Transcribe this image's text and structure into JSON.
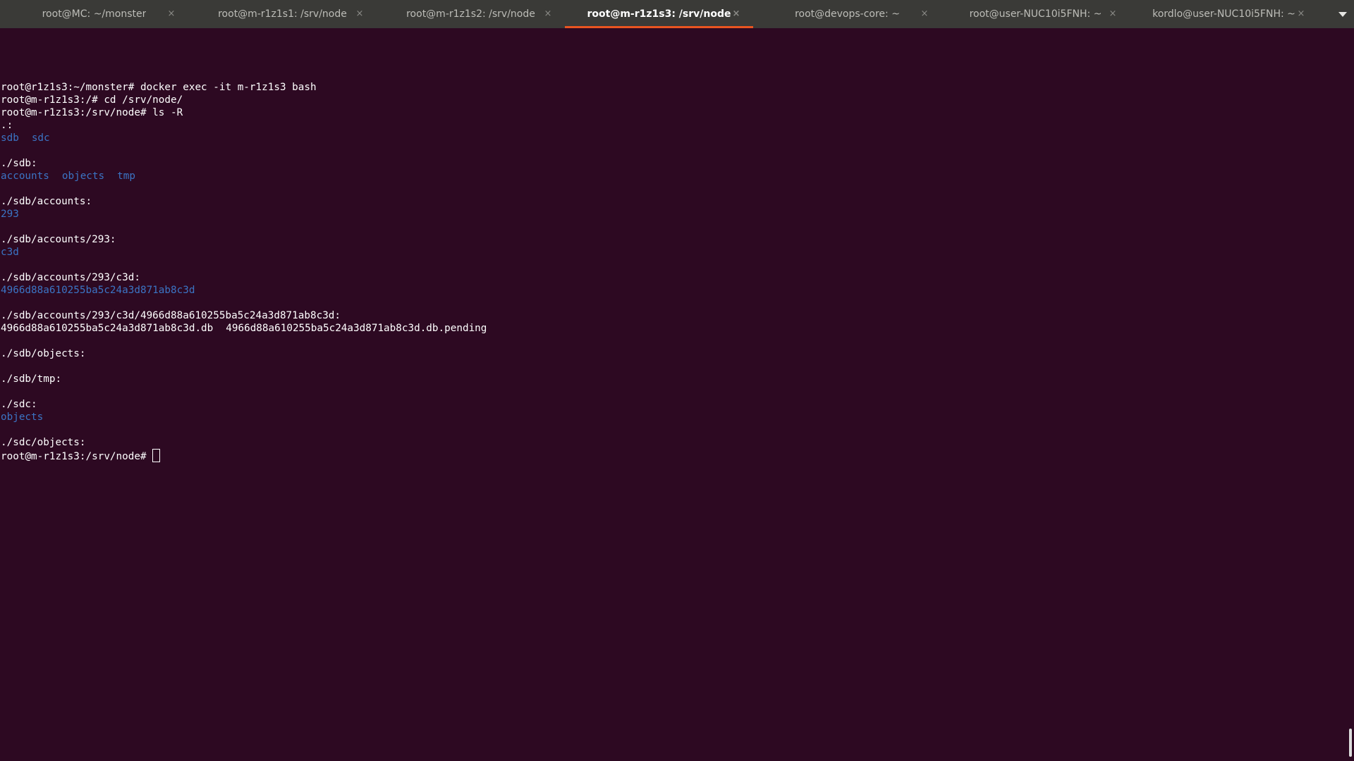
{
  "tabs": [
    {
      "label": "root@MC: ~/monster",
      "active": false
    },
    {
      "label": "root@m-r1z1s1: /srv/node",
      "active": false
    },
    {
      "label": "root@m-r1z1s2: /srv/node",
      "active": false
    },
    {
      "label": "root@m-r1z1s3: /srv/node",
      "active": true
    },
    {
      "label": "root@devops-core: ~",
      "active": false
    },
    {
      "label": "root@user-NUC10i5FNH: ~",
      "active": false
    },
    {
      "label": "kordlo@user-NUC10i5FNH: ~",
      "active": false
    }
  ],
  "tab_close_glyph": "×",
  "colors": {
    "terminal_bg": "#2d0922",
    "directory": "#3b74c4",
    "active_tab_underline": "#e95420",
    "tabbar_bg": "#3a3a37"
  },
  "terminal": {
    "line1": "root@r1z1s3:~/monster# docker exec -it m-r1z1s3 bash",
    "line2": "root@m-r1z1s3:/# cd /srv/node/",
    "line3": "root@m-r1z1s3:/srv/node# ls -R",
    "root_header": ".:",
    "root_dirs": [
      "sdb",
      "sdc"
    ],
    "sdb_header": "./sdb:",
    "sdb_dirs": [
      "accounts",
      "objects",
      "tmp"
    ],
    "accounts_header": "./sdb/accounts:",
    "accounts_dir": "293",
    "accounts293_header": "./sdb/accounts/293:",
    "accounts293_dir": "c3d",
    "c3d_header": "./sdb/accounts/293/c3d:",
    "c3d_dir": "4966d88a610255ba5c24a3d871ab8c3d",
    "hash_header": "./sdb/accounts/293/c3d/4966d88a610255ba5c24a3d871ab8c3d:",
    "hash_files": [
      "4966d88a610255ba5c24a3d871ab8c3d.db",
      "4966d88a610255ba5c24a3d871ab8c3d.db.pending"
    ],
    "sdb_objects_header": "./sdb/objects:",
    "sdb_tmp_header": "./sdb/tmp:",
    "sdc_header": "./sdc:",
    "sdc_dir": "objects",
    "sdc_objects_header": "./sdc/objects:",
    "prompt": "root@m-r1z1s3:/srv/node#"
  }
}
